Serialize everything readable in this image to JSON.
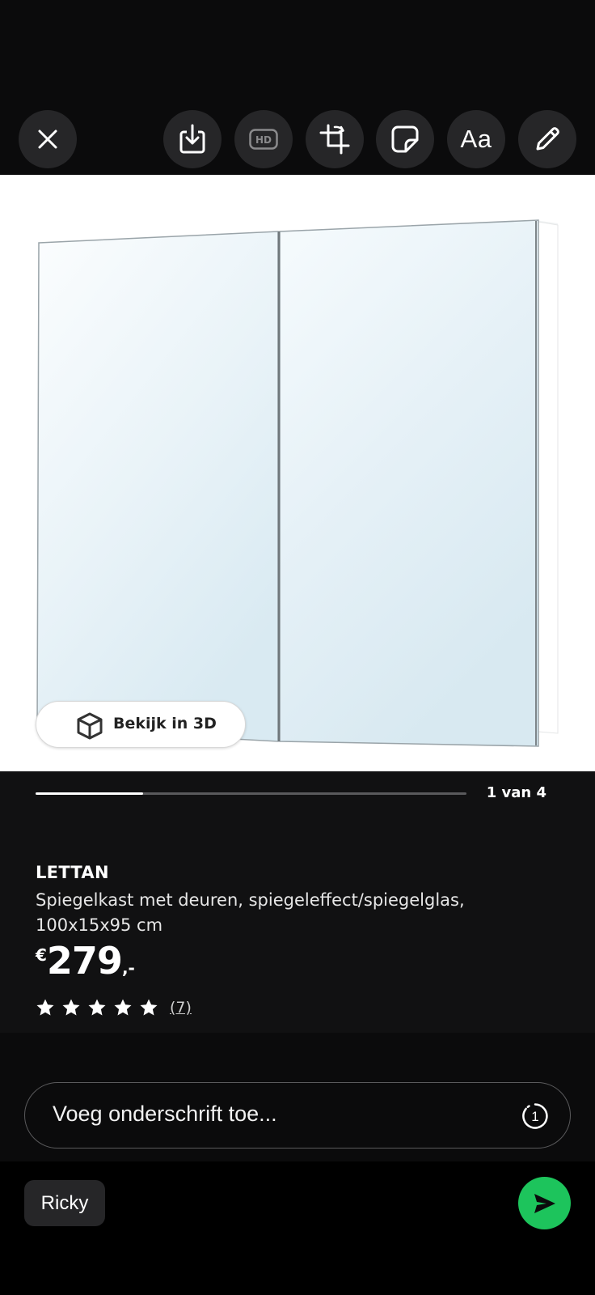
{
  "toolbar": {
    "close_icon": "close-icon",
    "download_icon": "download-icon",
    "hd_label": "HD",
    "crop_icon": "crop-rotate-icon",
    "sticker_icon": "sticker-icon",
    "text_label": "Aa",
    "draw_icon": "pencil-icon"
  },
  "product_image": {
    "view_3d_label": "Bekijk in 3D",
    "cube_icon": "cube-3d-icon"
  },
  "gallery": {
    "page_indicator": "1 van 4",
    "progress": 0.25
  },
  "product": {
    "name": "LETTAN",
    "description": "Spiegelkast met deuren, spiegeleffect/spiegelglas, 100x15x95 cm",
    "price_currency": "€",
    "price_amount": "279",
    "price_suffix": ",-",
    "rating_stars": 5,
    "review_count": "(7)"
  },
  "caption": {
    "placeholder": "Voeg onderschrift toe...",
    "timer_icon": "view-once-timer-icon",
    "timer_value": "1"
  },
  "footer": {
    "recipient": "Ricky",
    "send_icon": "send-icon"
  },
  "colors": {
    "background": "#0b0b0c",
    "panel": "#111112",
    "toolbar_button": "#262628",
    "send_accent": "#1dc45c"
  }
}
